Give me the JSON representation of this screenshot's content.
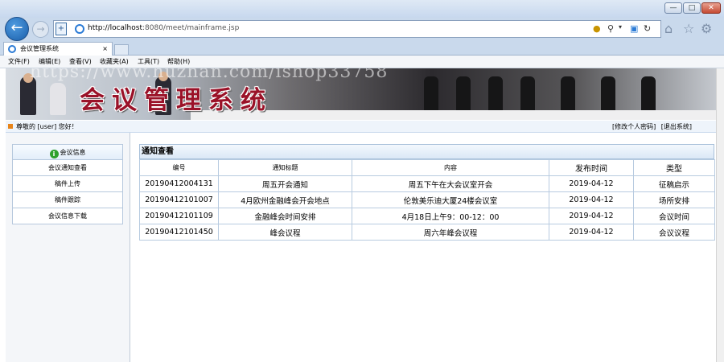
{
  "browser": {
    "url_host": "http://localhost",
    "url_rest": ":8080/meet/mainframe.jsp",
    "tab_title": "会议管理系统",
    "tab_close": "×",
    "back_glyph": "←",
    "forward_glyph": "→",
    "window_buttons": {
      "minimize": "—",
      "maximize": "□",
      "close": "✕"
    },
    "menus": [
      "文件(F)",
      "编辑(E)",
      "查看(V)",
      "收藏夹(A)",
      "工具(T)",
      "帮助(H)"
    ]
  },
  "banner": {
    "title": "会议管理系统",
    "watermark": "https://www.huzhan.com/ishop33758"
  },
  "userbar": {
    "greeting": "尊敬的 [user] 您好！",
    "links": [
      "[修改个人密码]",
      "[退出系统]"
    ]
  },
  "sidebar": {
    "header": "会议信息",
    "items": [
      "会议通知查看",
      "稿件上传",
      "稿件跟踪",
      "会议信息下载"
    ]
  },
  "panel": {
    "title": "通知查看",
    "columns": [
      "编号",
      "通知标题",
      "内容",
      "发布时间",
      "类型"
    ],
    "rows": [
      [
        "20190412004131",
        "周五开会通知",
        "周五下午在大会议室开会",
        "2019-04-12",
        "征稿启示"
      ],
      [
        "20190412101007",
        "4月欧州金融峰会开会地点",
        "伦敦美乐迪大厦24楼会议室",
        "2019-04-12",
        "场所安排"
      ],
      [
        "20190412101109",
        "金融峰会时间安排",
        "4月18日上午9：00-12：00",
        "2019-04-12",
        "会议时间"
      ],
      [
        "20190412101450",
        "峰会议程",
        "周六年峰会议程",
        "2019-04-12",
        "会议议程"
      ]
    ]
  },
  "colors": {
    "accent": "#2b7bd6",
    "banner_title": "#9a1228",
    "header_bg": "#dbe8f6"
  }
}
